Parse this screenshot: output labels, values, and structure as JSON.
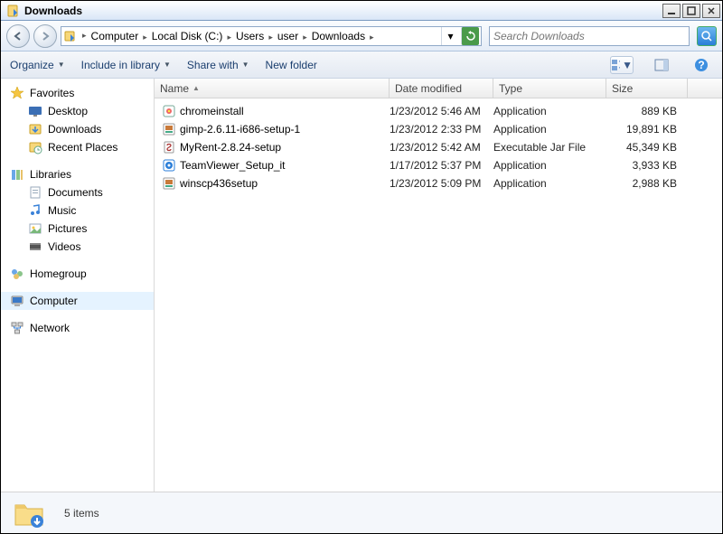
{
  "window": {
    "title": "Downloads"
  },
  "breadcrumbs": [
    "Computer",
    "Local Disk (C:)",
    "Users",
    "user",
    "Downloads"
  ],
  "search": {
    "placeholder": "Search Downloads"
  },
  "toolbar": {
    "organize": "Organize",
    "include": "Include in library",
    "share": "Share with",
    "newfolder": "New folder"
  },
  "sidebar": {
    "favorites": {
      "label": "Favorites",
      "items": [
        "Desktop",
        "Downloads",
        "Recent Places"
      ]
    },
    "libraries": {
      "label": "Libraries",
      "items": [
        "Documents",
        "Music",
        "Pictures",
        "Videos"
      ]
    },
    "homegroup": {
      "label": "Homegroup"
    },
    "computer": {
      "label": "Computer"
    },
    "network": {
      "label": "Network"
    }
  },
  "columns": {
    "name": "Name",
    "date": "Date modified",
    "type": "Type",
    "size": "Size"
  },
  "files": [
    {
      "name": "chromeinstall",
      "date": "1/23/2012 5:46 AM",
      "type": "Application",
      "size": "889 KB",
      "icon": "app"
    },
    {
      "name": "gimp-2.6.11-i686-setup-1",
      "date": "1/23/2012 2:33 PM",
      "type": "Application",
      "size": "19,891 KB",
      "icon": "installer"
    },
    {
      "name": "MyRent-2.8.24-setup",
      "date": "1/23/2012 5:42 AM",
      "type": "Executable Jar File",
      "size": "45,349 KB",
      "icon": "jar"
    },
    {
      "name": "TeamViewer_Setup_it",
      "date": "1/17/2012 5:37 PM",
      "type": "Application",
      "size": "3,933 KB",
      "icon": "tv"
    },
    {
      "name": "winscp436setup",
      "date": "1/23/2012 5:09 PM",
      "type": "Application",
      "size": "2,988 KB",
      "icon": "installer"
    }
  ],
  "status": {
    "count": "5 items"
  }
}
